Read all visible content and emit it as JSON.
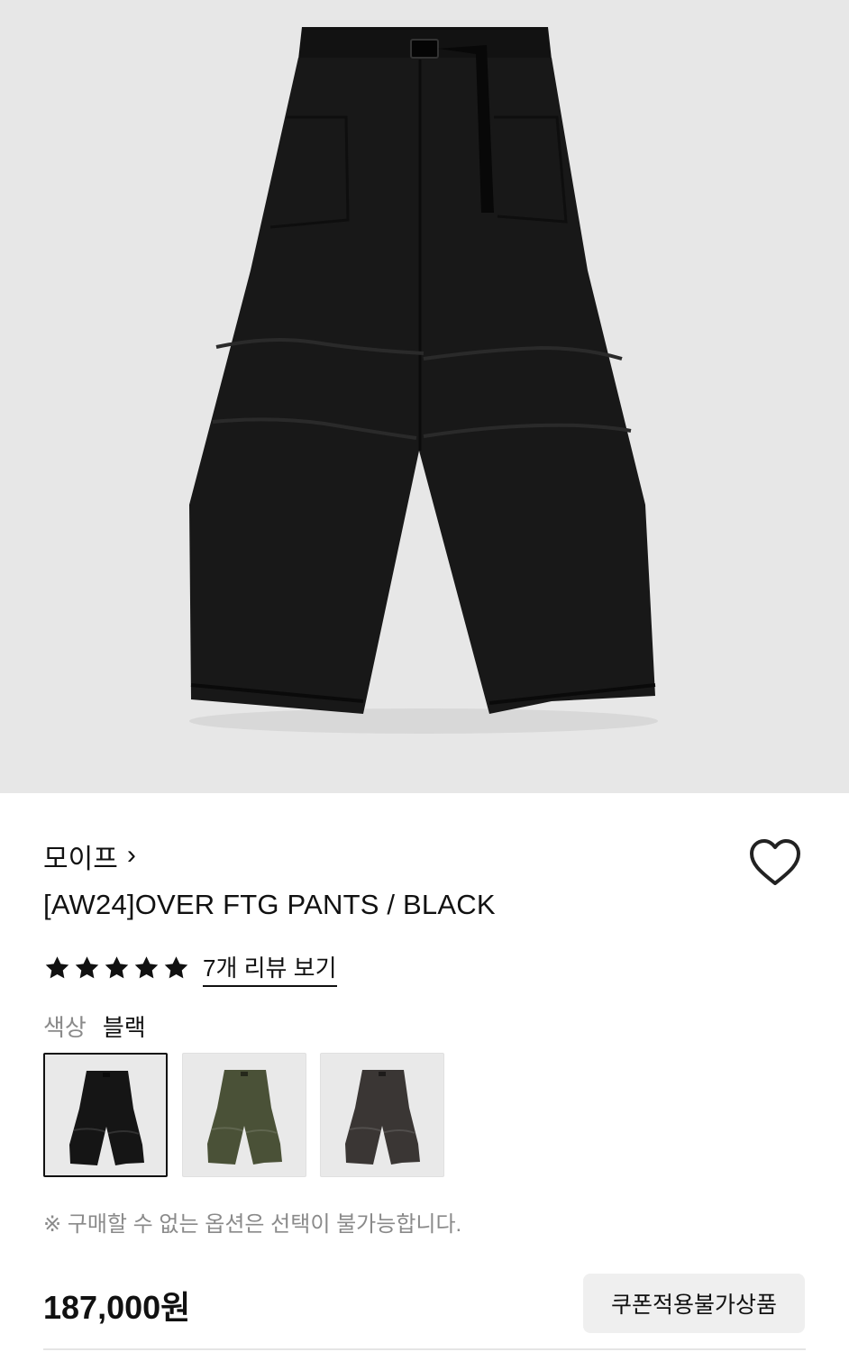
{
  "product": {
    "brand": "모이프",
    "brand_chevron": "›",
    "title": "[AW24]OVER FTG PANTS / BLACK",
    "rating_stars": 5,
    "review_link": "7개 리뷰 보기",
    "color_label": "색상",
    "color_value": "블랙",
    "swatches": [
      {
        "name": "black",
        "color": "#151515",
        "selected": true
      },
      {
        "name": "olive",
        "color": "#4a5137",
        "selected": false
      },
      {
        "name": "charcoal",
        "color": "#3a3634",
        "selected": false
      }
    ],
    "notice": "※ 구매할 수 없는 옵션은 선택이 불가능합니다.",
    "price": "187,000원",
    "coupon_label": "쿠폰적용불가상품"
  },
  "colors": {
    "hero_bg": "#e7e7e7",
    "pants_main": "#161616",
    "star": "#111111"
  },
  "icons": {
    "wishlist": "heart-outline-icon",
    "rating": "star-icon",
    "brand_link": "chevron-right-icon"
  }
}
